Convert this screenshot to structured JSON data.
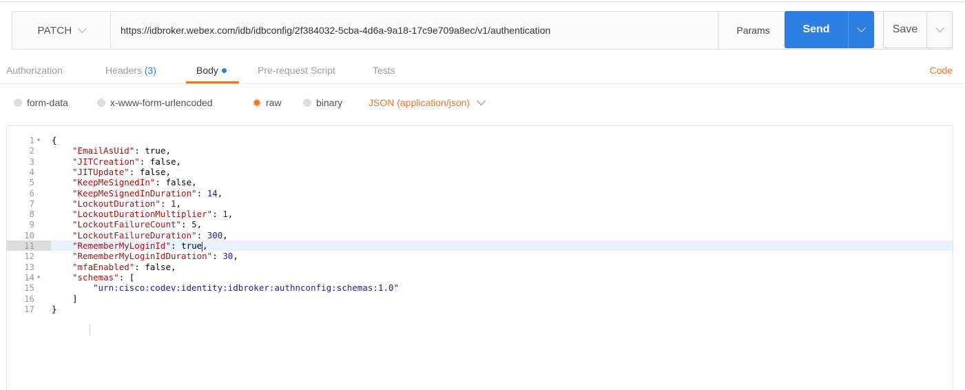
{
  "request": {
    "method": "PATCH",
    "url": "https://idbroker.webex.com/idb/idbconfig/2f384032-5cba-4d6a-9a18-17c9e709a8ec/v1/authentication",
    "params_label": "Params",
    "send_label": "Send",
    "save_label": "Save"
  },
  "tabs": [
    {
      "label": "Authorization"
    },
    {
      "label": "Headers",
      "count": "(3)"
    },
    {
      "label": "Body",
      "active": true
    },
    {
      "label": "Pre-request Script"
    },
    {
      "label": "Tests"
    }
  ],
  "code_link": "Code",
  "body_types": {
    "options": [
      "form-data",
      "x-www-form-urlencoded",
      "raw",
      "binary"
    ],
    "selected": "raw",
    "content_type": "JSON (application/json)"
  },
  "editor": {
    "highlighted_line": 11,
    "lines": [
      {
        "n": "1",
        "fold": true,
        "text": "{"
      },
      {
        "n": "2",
        "key": "\"EmailAsUid\"",
        "value": "true",
        "vt": "lit",
        "trail": ","
      },
      {
        "n": "3",
        "key": "\"JITCreation\"",
        "value": "false",
        "vt": "lit",
        "trail": ","
      },
      {
        "n": "4",
        "key": "\"JITUpdate\"",
        "value": "false",
        "vt": "lit",
        "trail": ","
      },
      {
        "n": "5",
        "key": "\"KeepMeSignedIn\"",
        "value": "false",
        "vt": "lit",
        "trail": ","
      },
      {
        "n": "6",
        "key": "\"KeepMeSignedInDuration\"",
        "value": "14",
        "vt": "num",
        "trail": ","
      },
      {
        "n": "7",
        "key": "\"LockoutDuration\"",
        "value": "1",
        "vt": "num",
        "trail": ","
      },
      {
        "n": "8",
        "key": "\"LockoutDurationMultiplier\"",
        "value": "1",
        "vt": "num",
        "trail": ","
      },
      {
        "n": "9",
        "key": "\"LockoutFailureCount\"",
        "value": "5",
        "vt": "num",
        "trail": ","
      },
      {
        "n": "10",
        "key": "\"LockoutFailureDuration\"",
        "value": "300",
        "vt": "num",
        "trail": ","
      },
      {
        "n": "11",
        "key": "\"RememberMyLoginId\"",
        "value": "true",
        "vt": "lit",
        "trail": ","
      },
      {
        "n": "12",
        "key": "\"RememberMyLoginIdDuration\"",
        "value": "30",
        "vt": "num",
        "trail": ","
      },
      {
        "n": "13",
        "key": "\"mfaEnabled\"",
        "value": "false",
        "vt": "lit",
        "trail": ","
      },
      {
        "n": "14",
        "fold": true,
        "key": "\"schemas\"",
        "value": "[",
        "vt": "lit",
        "trail": ""
      },
      {
        "n": "15",
        "indent": 2,
        "text": "\"urn:cisco:codev:identity:idbroker:authnconfig:schemas:1.0\"",
        "tt": "str"
      },
      {
        "n": "16",
        "text": "]",
        "indent": 1
      },
      {
        "n": "17",
        "text": "}",
        "indent": 0
      }
    ]
  }
}
